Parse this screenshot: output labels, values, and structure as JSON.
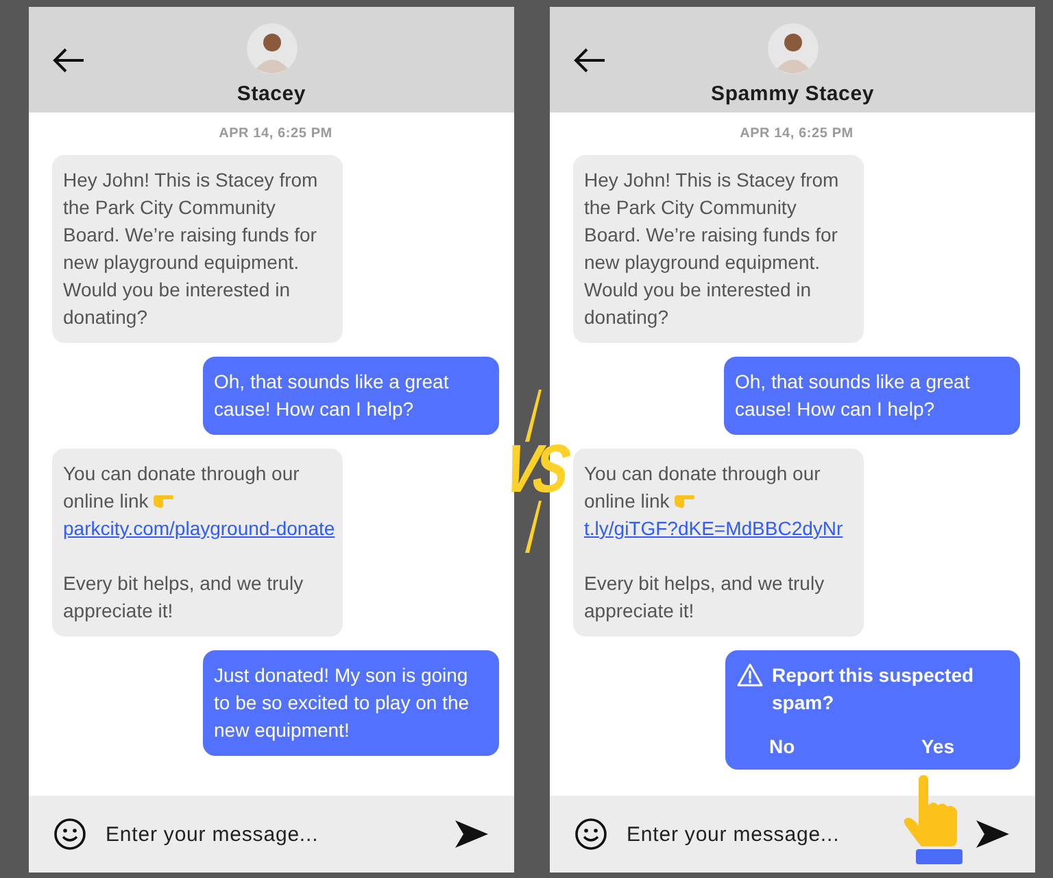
{
  "screens": [
    {
      "contact_name": "Stacey",
      "timestamp": "APR 14, 6:25 PM",
      "messages": [
        {
          "kind": "incoming",
          "text": "Hey John! This is Stacey from the Park City Community Board. We’re raising funds for new playground equipment. Would you be interested in donating?"
        },
        {
          "kind": "outgoing",
          "text": "Oh, that sounds like a great cause! How can I help?"
        },
        {
          "kind": "incoming_link",
          "text": "You can donate through our online link",
          "link": "parkcity.com/playground-donate",
          "footer": "Every bit helps, and we truly appreciate it!"
        },
        {
          "kind": "outgoing",
          "text": "Just donated! My son is going to be so excited to play on the new equipment!"
        }
      ],
      "composer": {
        "placeholder": "Enter your message..."
      }
    },
    {
      "contact_name": "Spammy Stacey",
      "timestamp": "APR 14, 6:25 PM",
      "messages": [
        {
          "kind": "incoming",
          "text": "Hey John! This is Stacey from the Park City Community Board. We’re raising funds for new playground equipment. Would you be interested in donating?"
        },
        {
          "kind": "outgoing",
          "text": "Oh, that sounds like a great cause! How can I help?"
        },
        {
          "kind": "incoming_link",
          "text": "You can donate through our online link",
          "link": "t.ly/giTGF?dKE=MdBBC2dyNr",
          "footer": "Every bit helps, and we truly appreciate it!"
        },
        {
          "kind": "spam_prompt",
          "text": "Report this suspected spam?",
          "options": [
            "No",
            "Yes"
          ]
        }
      ],
      "composer": {
        "placeholder": "Enter your message..."
      }
    }
  ],
  "divider_label": "VS"
}
